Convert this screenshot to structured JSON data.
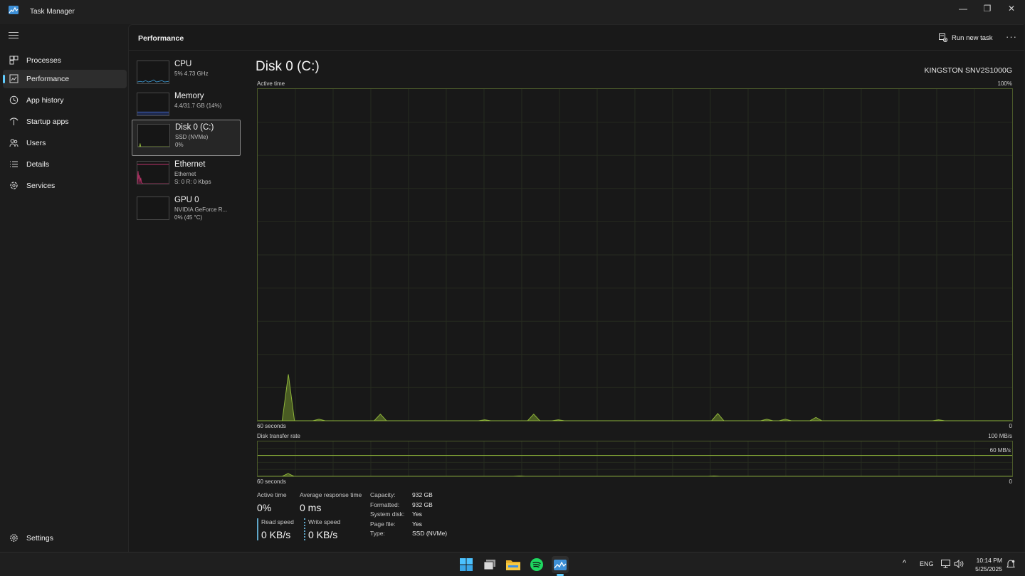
{
  "window": {
    "title": "Task Manager",
    "controls": {
      "minimize": "—",
      "restore": "❐",
      "close": "✕"
    }
  },
  "nav": {
    "items": [
      {
        "label": "Processes",
        "icon": "processes-icon"
      },
      {
        "label": "Performance",
        "icon": "performance-icon",
        "active": true
      },
      {
        "label": "App history",
        "icon": "app-history-icon"
      },
      {
        "label": "Startup apps",
        "icon": "startup-apps-icon"
      },
      {
        "label": "Users",
        "icon": "users-icon"
      },
      {
        "label": "Details",
        "icon": "details-icon"
      },
      {
        "label": "Services",
        "icon": "services-icon"
      }
    ],
    "settings": "Settings"
  },
  "header": {
    "title": "Performance",
    "run_new_task": "Run new task",
    "more": "···"
  },
  "devices": [
    {
      "name": "CPU",
      "line1": "5% 4.73 GHz",
      "line2": "",
      "color": "#3b8ec2"
    },
    {
      "name": "Memory",
      "line1": "4.4/31.7 GB (14%)",
      "line2": "",
      "color": "#4464c8"
    },
    {
      "name": "Disk 0 (C:)",
      "line1": "SSD (NVMe)",
      "line2": "0%",
      "color": "#8db33a",
      "selected": true
    },
    {
      "name": "Ethernet",
      "line1": "Ethernet",
      "line2": "S: 0 R: 0 Kbps",
      "color": "#c4346e"
    },
    {
      "name": "GPU 0",
      "line1": "NVIDIA GeForce R...",
      "line2": "0% (45 °C)",
      "color": "#2f8f8f"
    }
  ],
  "disk": {
    "title": "Disk 0 (C:)",
    "model": "KINGSTON SNV2S1000G",
    "active_time_label": "Active time",
    "active_time_max": "100%",
    "seconds_label": "60 seconds",
    "zero": "0",
    "transfer_label": "Disk transfer rate",
    "transfer_max": "100 MB/s",
    "transfer_line": "60 MB/s",
    "accent": "#8db33a",
    "active_time_series": [
      0,
      0,
      0,
      0,
      0,
      14,
      0,
      0,
      0,
      0,
      0.5,
      0,
      0,
      0,
      0,
      0,
      0,
      0,
      0,
      0,
      2,
      0,
      0,
      0,
      0,
      0,
      0,
      0,
      0,
      0,
      0,
      0,
      0,
      0,
      0,
      0,
      0,
      0.3,
      0,
      0,
      0,
      0,
      0,
      0,
      0,
      2,
      0,
      0,
      0,
      0.3,
      0,
      0,
      0,
      0,
      0,
      0,
      0,
      0,
      0,
      0,
      0,
      0,
      0,
      0,
      0,
      0,
      0,
      0,
      0,
      0,
      0,
      0,
      0,
      0,
      0,
      2.2,
      0,
      0,
      0,
      0,
      0,
      0,
      0,
      0.5,
      0,
      0,
      0.5,
      0,
      0,
      0,
      0,
      1,
      0,
      0,
      0,
      0,
      0,
      0,
      0,
      0,
      0,
      0,
      0,
      0,
      0,
      0,
      0,
      0,
      0,
      0,
      0,
      0.3,
      0,
      0,
      0,
      0,
      0,
      0,
      0,
      0,
      0,
      0,
      0,
      0
    ],
    "transfer_series": [
      0,
      0,
      0,
      0,
      0,
      8,
      0,
      0,
      0,
      0,
      0,
      0,
      0,
      0,
      0,
      0,
      0,
      0,
      0,
      0,
      0,
      0,
      0,
      0,
      0,
      0,
      0,
      0,
      0,
      0,
      0,
      0,
      0,
      0,
      0,
      0,
      0,
      0,
      0,
      0,
      0,
      0,
      0,
      1,
      0,
      0,
      0,
      0,
      0,
      0,
      0,
      0,
      0,
      0,
      0,
      0,
      0,
      0,
      0,
      0,
      0,
      0,
      0,
      0,
      0,
      0,
      0,
      0,
      0,
      0,
      0,
      0,
      0,
      0,
      0,
      1,
      0,
      0,
      0,
      0,
      0,
      0,
      0,
      0,
      0,
      0,
      0,
      0,
      0,
      0,
      0,
      0,
      0,
      0,
      0,
      0,
      0,
      0,
      0,
      0,
      0,
      0,
      0,
      0,
      0,
      0,
      0,
      0,
      0,
      0,
      0,
      0,
      0,
      0,
      0,
      0,
      0,
      0,
      0,
      0,
      0,
      0,
      0,
      0,
      0
    ]
  },
  "stats": {
    "active_time_label": "Active time",
    "active_time_value": "0%",
    "avg_response_label": "Average response time",
    "avg_response_value": "0 ms",
    "read_speed_label": "Read speed",
    "read_speed_value": "0 KB/s",
    "write_speed_label": "Write speed",
    "write_speed_value": "0 KB/s",
    "props": [
      {
        "key": "Capacity:",
        "value": "932 GB"
      },
      {
        "key": "Formatted:",
        "value": "932 GB"
      },
      {
        "key": "System disk:",
        "value": "Yes"
      },
      {
        "key": "Page file:",
        "value": "Yes"
      },
      {
        "key": "Type:",
        "value": "SSD (NVMe)"
      }
    ]
  },
  "taskbar": {
    "apps": [
      "windows-start-icon",
      "task-view-icon",
      "file-explorer-icon",
      "spotify-icon",
      "task-manager-icon"
    ],
    "tray": {
      "chevron": "^",
      "language": "ENG"
    },
    "time": "10:14 PM",
    "date": "5/25/2025"
  }
}
